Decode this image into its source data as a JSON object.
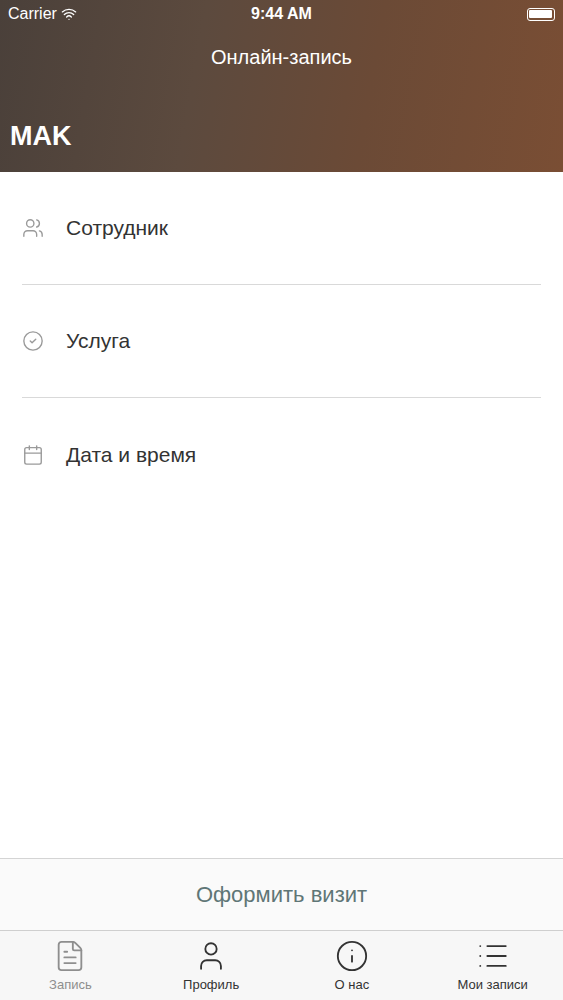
{
  "status_bar": {
    "carrier": "Carrier",
    "time": "9:44 AM"
  },
  "header": {
    "title": "Онлайн-запись",
    "name": "MAK"
  },
  "rows": [
    {
      "label": "Сотрудник"
    },
    {
      "label": "Услуга"
    },
    {
      "label": "Дата и время"
    }
  ],
  "submit_button": "Оформить визит",
  "tabs": [
    {
      "label": "Запись",
      "selected": true
    },
    {
      "label": "Профиль",
      "selected": false
    },
    {
      "label": "О нас",
      "selected": false
    },
    {
      "label": "Мои записи",
      "selected": false
    }
  ]
}
